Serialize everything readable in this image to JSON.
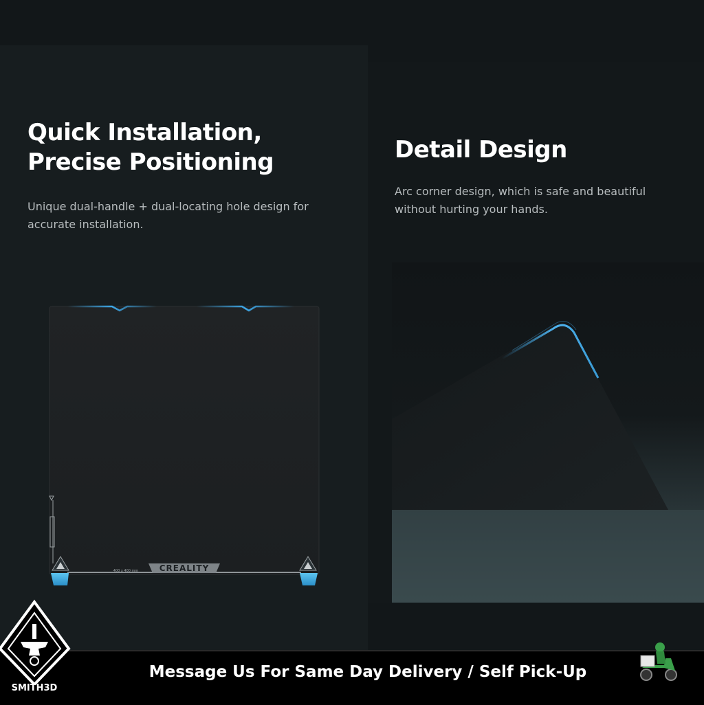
{
  "left_section": {
    "heading_line1": "Quick Installation,",
    "heading_line2": "Precise Positioning",
    "body_line1": "Unique dual-handle + dual-locating hole design for",
    "body_line2": "accurate installation."
  },
  "right_section": {
    "heading": "Detail Design",
    "body_line1": "Arc corner design, which is safe and beautiful",
    "body_line2": "without hurting your hands."
  },
  "plate": {
    "brand_label": "CREALITY",
    "size_label": "400 x 400 mm"
  },
  "footer": {
    "message": "Message Us For Same Day Delivery / Self Pick-Up",
    "logo_name": "SMITH3D"
  },
  "colors": {
    "background": "#121719",
    "accent_blue": "#3ea8e8",
    "footer_bg": "#000000"
  },
  "icons": {
    "logo": "anvil-logo-icon",
    "delivery": "scooter-delivery-icon"
  }
}
